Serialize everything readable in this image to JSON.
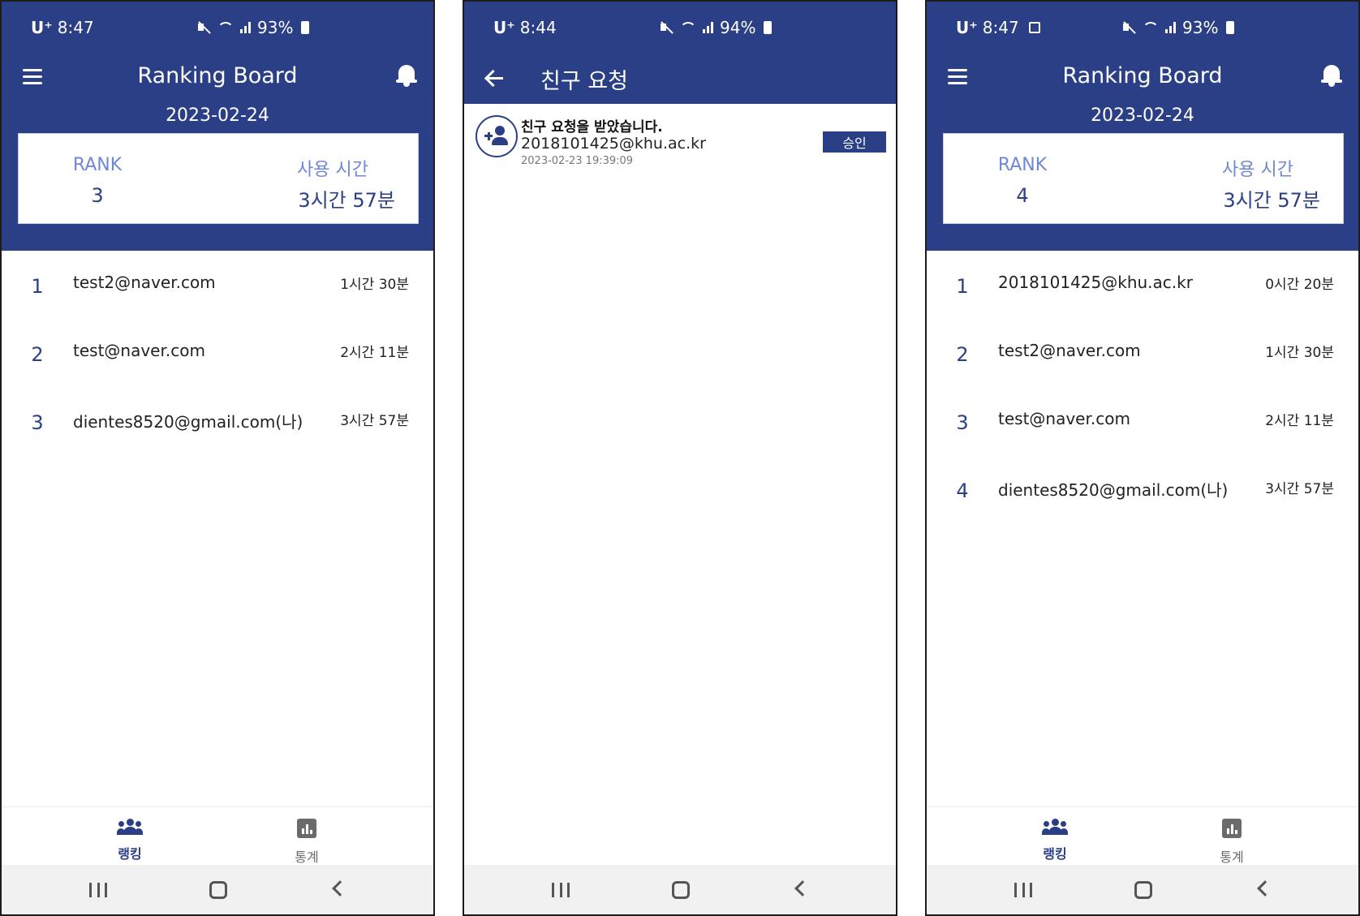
{
  "screens": [
    {
      "status": {
        "carrier": "U⁺",
        "time": "8:47",
        "battery": "93%"
      },
      "title": "Ranking Board",
      "date": "2023-02-24",
      "card": {
        "rank_label": "RANK",
        "rank_value": "3",
        "time_label": "사용 시간",
        "time_value": "3시간 57분"
      },
      "rows": [
        {
          "num": "1",
          "email": "test2@naver.com",
          "time": "1시간 30분"
        },
        {
          "num": "2",
          "email": "test@naver.com",
          "time": "2시간 11분"
        },
        {
          "num": "3",
          "email": "dientes8520@gmail.com(나)",
          "time": "3시간 57분"
        }
      ],
      "nav": {
        "ranking": "랭킹",
        "stats": "통계"
      }
    },
    {
      "status": {
        "carrier": "U⁺",
        "time": "8:44",
        "battery": "94%"
      },
      "title": "친구 요청",
      "notification": {
        "title": "친구 요청을 받았습니다.",
        "email": "2018101425@khu.ac.kr",
        "timestamp": "2023-02-23 19:39:09",
        "button": "승인"
      }
    },
    {
      "status": {
        "carrier": "U⁺",
        "time": "8:47",
        "battery": "93%"
      },
      "title": "Ranking Board",
      "date": "2023-02-24",
      "card": {
        "rank_label": "RANK",
        "rank_value": "4",
        "time_label": "사용 시간",
        "time_value": "3시간 57분"
      },
      "rows": [
        {
          "num": "1",
          "email": "2018101425@khu.ac.kr",
          "time": "0시간 20분"
        },
        {
          "num": "2",
          "email": "test2@naver.com",
          "time": "1시간 30분"
        },
        {
          "num": "3",
          "email": "test@naver.com",
          "time": "2시간 11분"
        },
        {
          "num": "4",
          "email": "dientes8520@gmail.com(나)",
          "time": "3시간 57분"
        }
      ],
      "nav": {
        "ranking": "랭킹",
        "stats": "통계"
      }
    }
  ],
  "colors": {
    "primary": "#2a3f86",
    "accent_label": "#6f87d6"
  }
}
